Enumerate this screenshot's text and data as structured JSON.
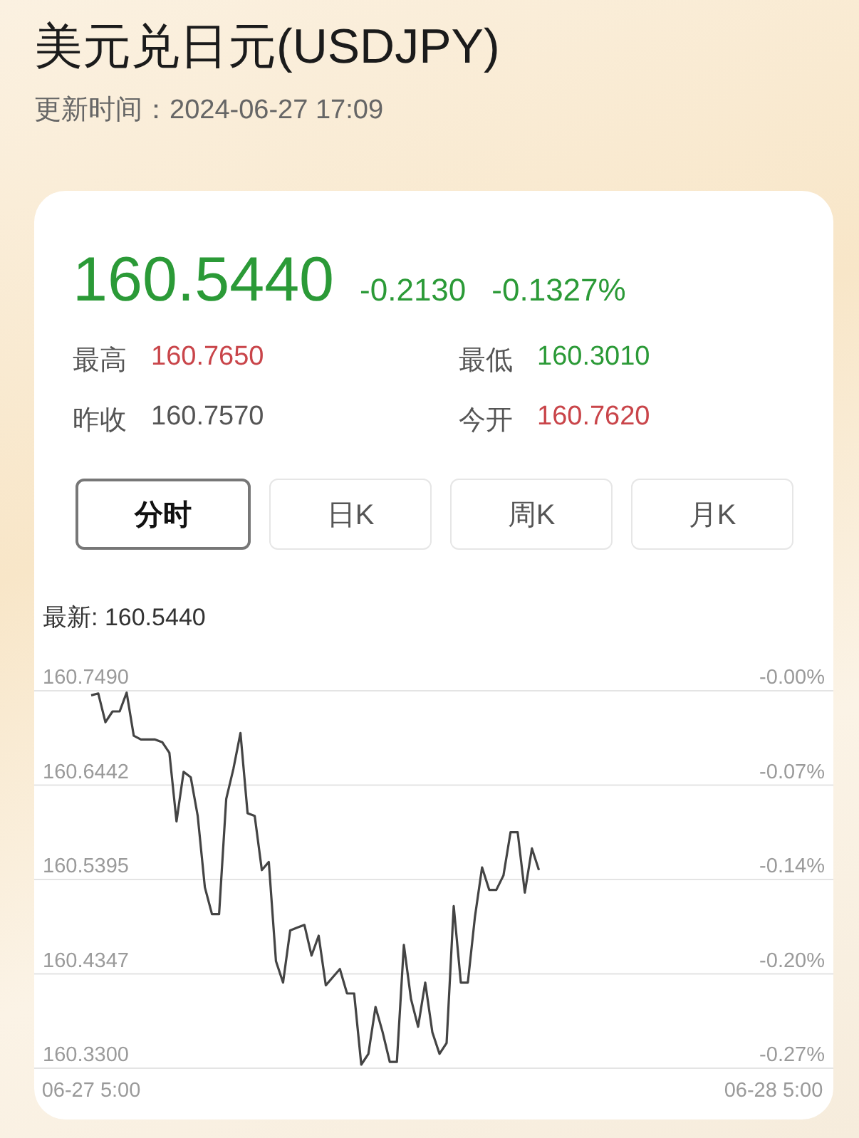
{
  "header": {
    "title": "美元兑日元(USDJPY)",
    "update_time": "更新时间：2024-06-27 17:09"
  },
  "quote": {
    "price": "160.5440",
    "change": "-0.2130",
    "change_percent": "-0.1327%",
    "color": "#2b9a37",
    "stats": [
      {
        "label": "最高",
        "value": "160.7650",
        "color": "#c9454a"
      },
      {
        "label": "最低",
        "value": "160.3010",
        "color": "#2b9a37"
      },
      {
        "label": "昨收",
        "value": "160.7570",
        "color": "#555555"
      },
      {
        "label": "今开",
        "value": "160.7620",
        "color": "#c9454a"
      }
    ]
  },
  "tabs": [
    {
      "label": "分时",
      "selected": true
    },
    {
      "label": "日K",
      "selected": false
    },
    {
      "label": "周K",
      "selected": false
    },
    {
      "label": "月K",
      "selected": false
    }
  ],
  "chart": {
    "latest": "最新: 160.5440",
    "percent_labels": [
      "-0.00%",
      "-0.07%",
      "-0.14%",
      "-0.20%",
      "-0.27%"
    ],
    "chart_data": {
      "type": "line",
      "grid": true,
      "ylim": [
        160.33,
        160.749
      ],
      "categories": [
        "06-27 5:00",
        null,
        null,
        null,
        null,
        null,
        null,
        null,
        null,
        null,
        null,
        null,
        null,
        null,
        null,
        null,
        null,
        null,
        null,
        null,
        null,
        null,
        null,
        null,
        null,
        null,
        null,
        null,
        null,
        null,
        null,
        null,
        null,
        null,
        null,
        null,
        null,
        null,
        null,
        null,
        null,
        null,
        null,
        null,
        null,
        null,
        null,
        null,
        null,
        null,
        null,
        null,
        null,
        null,
        null,
        null,
        null,
        null,
        null,
        null,
        null,
        null,
        null,
        null,
        null,
        null,
        null,
        null,
        null,
        null,
        null,
        null,
        null,
        null,
        null,
        null,
        null,
        null,
        null,
        null,
        null,
        null,
        null,
        null,
        null,
        null,
        null,
        null,
        null,
        null,
        null,
        null,
        null,
        null,
        null,
        null,
        "06-28 5:00"
      ],
      "yticks": [
        {
          "value": 160.749,
          "label": "160.7490"
        },
        {
          "value": 160.6442,
          "label": "160.6442"
        },
        {
          "value": 160.5395,
          "label": "160.5395"
        },
        {
          "value": 160.4347,
          "label": "160.4347"
        },
        {
          "value": 160.33,
          "label": "160.3300"
        }
      ],
      "series": [
        {
          "color": "#444444",
          "values": [
            160.744,
            160.746,
            160.714,
            160.726,
            160.726,
            160.747,
            160.699,
            160.695,
            160.695,
            160.695,
            160.692,
            160.68,
            160.604,
            160.659,
            160.653,
            160.61,
            160.531,
            160.501,
            160.501,
            160.629,
            160.662,
            160.702,
            160.613,
            160.61,
            160.55,
            160.559,
            160.449,
            160.425,
            160.483,
            160.486,
            160.489,
            160.455,
            160.477,
            160.422,
            160.431,
            160.44,
            160.413,
            160.413,
            160.334,
            160.346,
            160.398,
            160.37,
            160.337,
            160.337,
            160.467,
            160.407,
            160.376,
            160.425,
            160.37,
            160.346,
            160.358,
            160.51,
            160.425,
            160.425,
            160.498,
            160.553,
            160.528,
            160.528,
            160.544,
            160.592,
            160.592,
            160.525,
            160.574,
            160.55,
            null,
            null,
            null,
            null,
            null,
            null,
            null,
            null,
            null,
            null,
            null,
            null,
            null,
            null,
            null,
            null,
            null,
            null,
            null,
            null,
            null,
            null,
            null,
            null,
            null,
            null,
            null,
            null,
            null,
            null,
            null,
            null,
            null
          ]
        }
      ]
    }
  }
}
